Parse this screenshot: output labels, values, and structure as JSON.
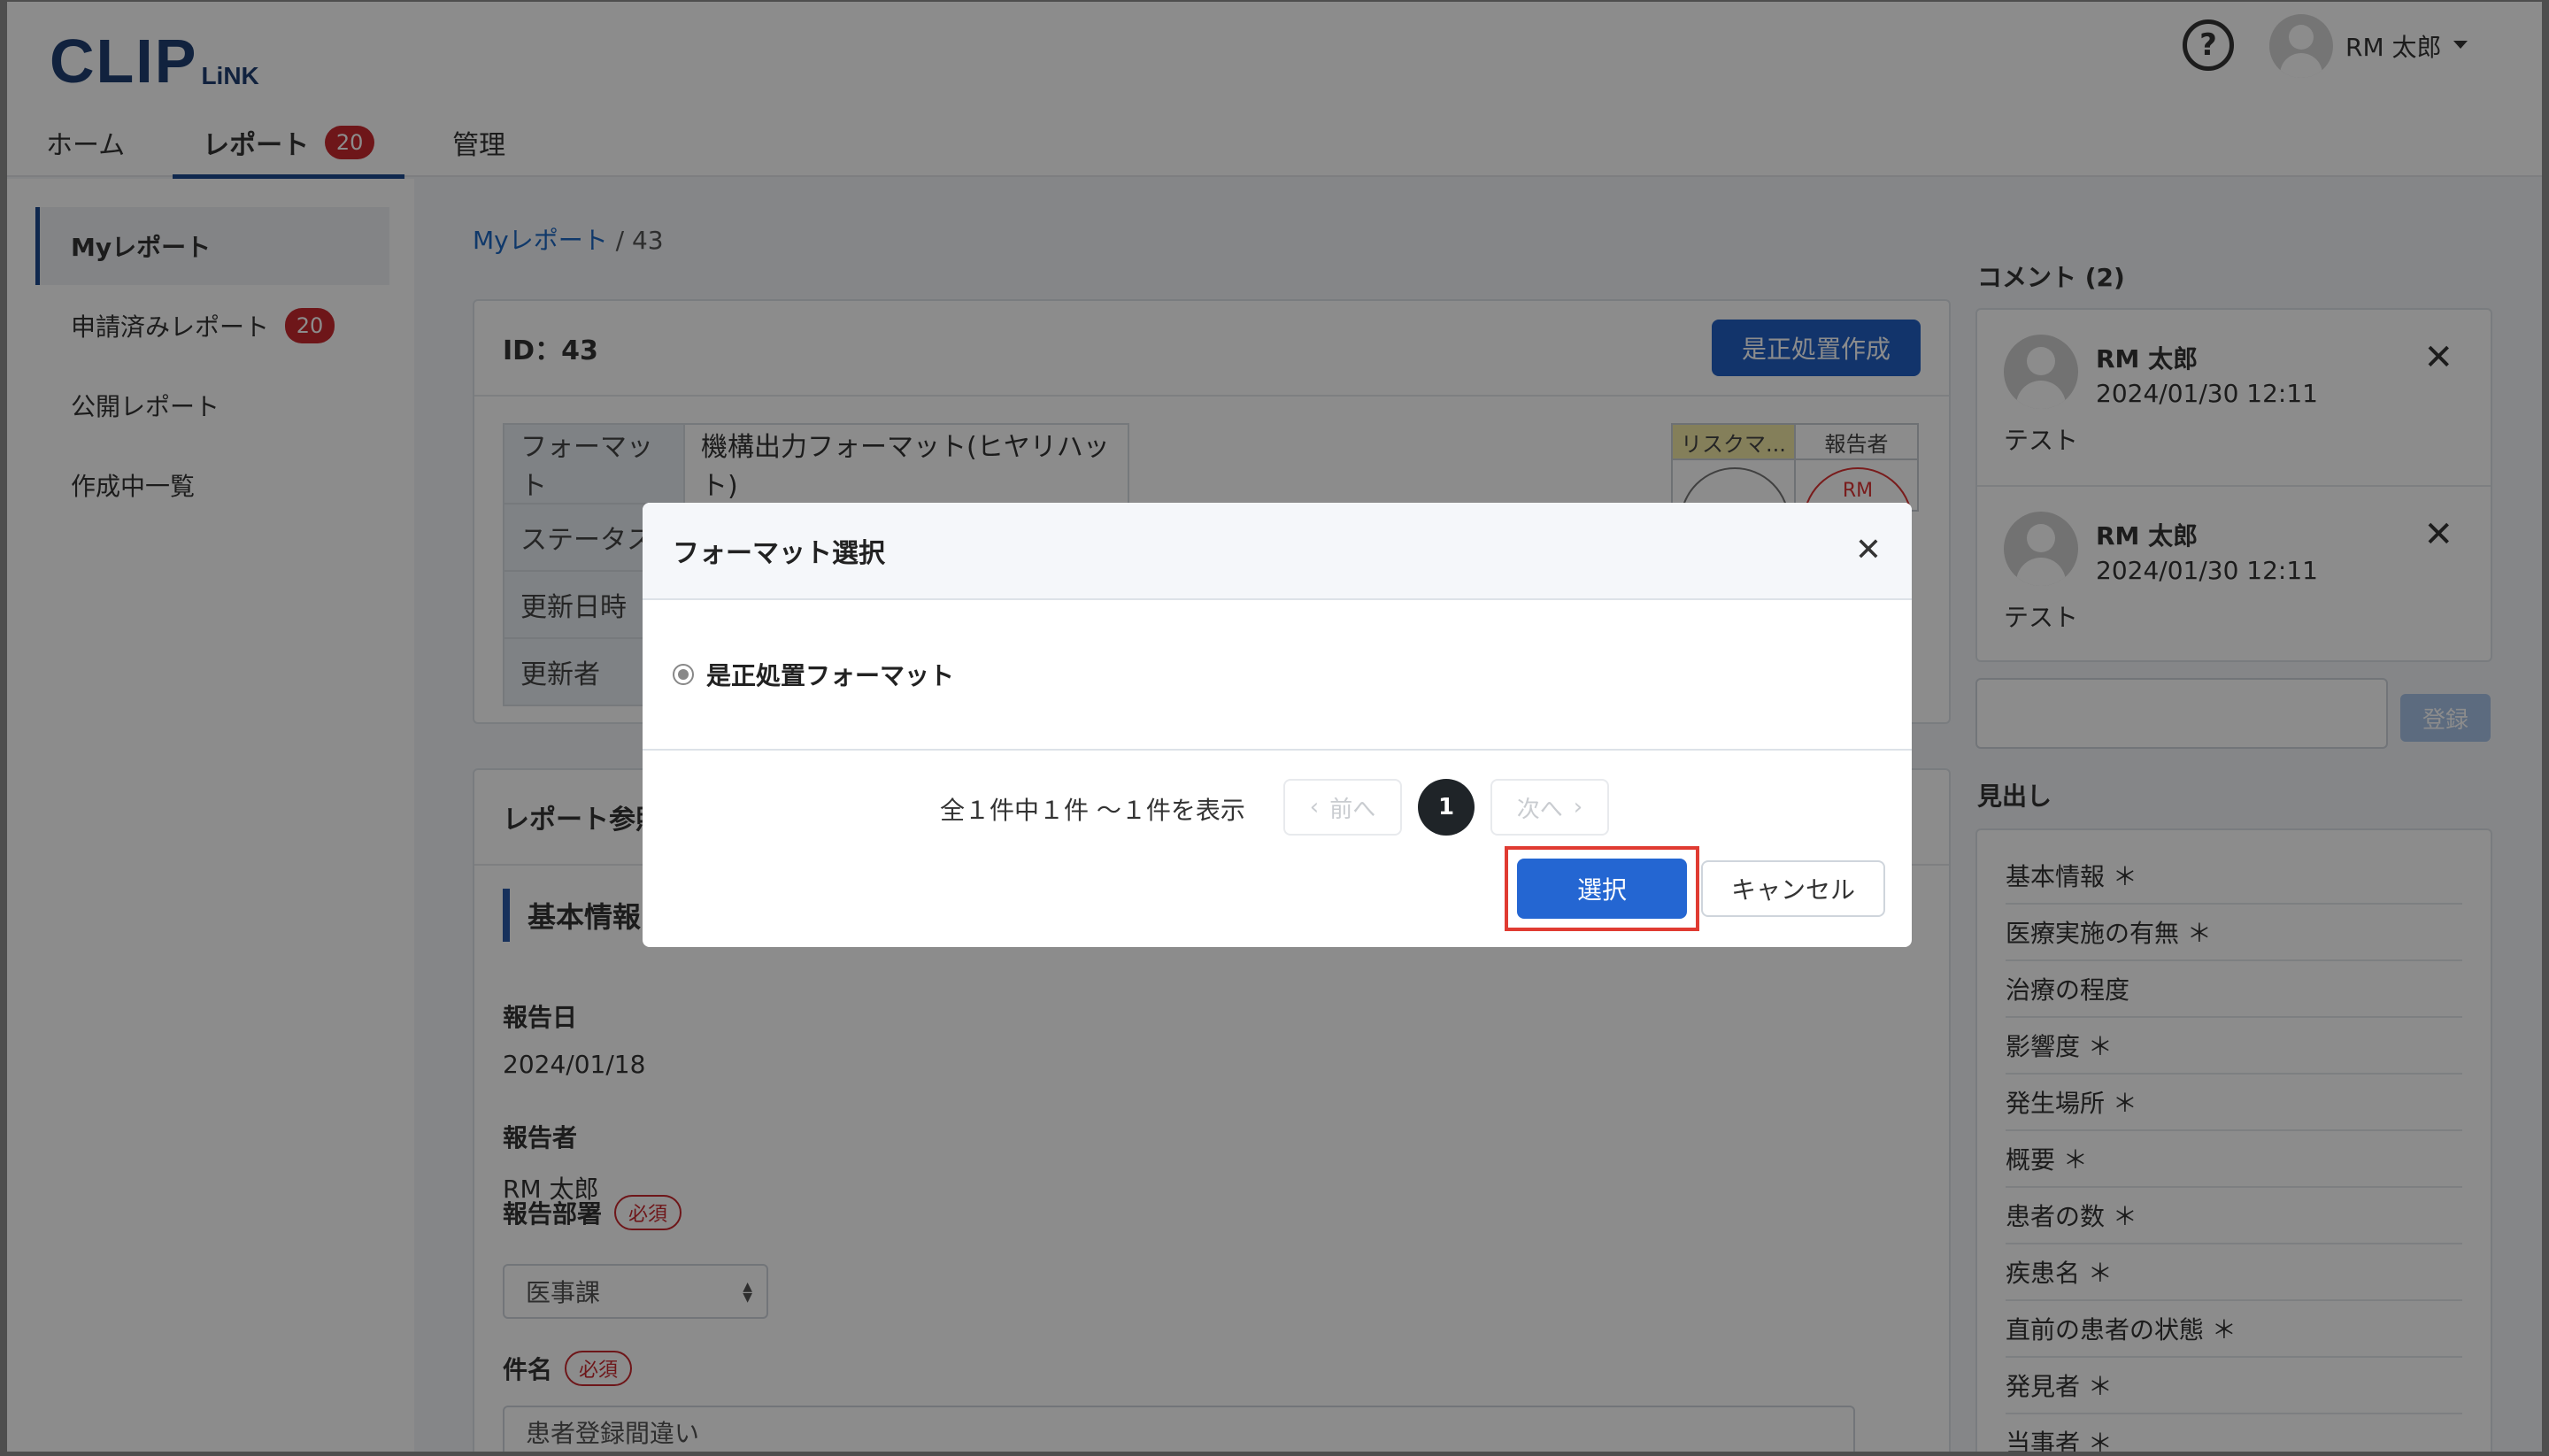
{
  "app": {
    "logo_main": "CLIP",
    "logo_sub": "LiNK",
    "help_icon_glyph": "?",
    "user_name": "RM 太郎"
  },
  "nav": {
    "tabs": [
      {
        "label": "ホーム"
      },
      {
        "label": "レポート",
        "badge": "20"
      },
      {
        "label": "管理"
      }
    ]
  },
  "sidebar": {
    "items": [
      {
        "label": "Myレポート"
      },
      {
        "label": "申請済みレポート",
        "badge": "20"
      },
      {
        "label": "公開レポート"
      },
      {
        "label": "作成中一覧"
      }
    ]
  },
  "breadcrumb": {
    "link": "Myレポート",
    "separator": "/",
    "current": "43"
  },
  "report": {
    "id_label": "ID：43",
    "corrective_button": "是正処置作成",
    "info": [
      {
        "key": "フォーマット",
        "value": "機構出力フォーマット(ヒヤリハット)"
      },
      {
        "key": "ステータス",
        "value": ""
      },
      {
        "key": "更新日時",
        "value": ""
      },
      {
        "key": "更新者",
        "value": ""
      }
    ],
    "stamp": {
      "col1_header": "リスクマ...",
      "col2_header": "報告者",
      "col2_mark": "RM"
    },
    "ref_title": "レポート参照",
    "section_title": "基本情報",
    "fields": {
      "report_date_label": "報告日",
      "report_date_value": "2024/01/18",
      "reporter_label": "報告者",
      "reporter_value": "RM 太郎",
      "dept_label": "報告部署",
      "dept_required": "必須",
      "dept_value": "医事課",
      "subject_label": "件名",
      "subject_required": "必須",
      "subject_value": "患者登録間違い"
    }
  },
  "comments": {
    "title": "コメント (2)",
    "items": [
      {
        "author": "RM 太郎",
        "date": "2024/01/30 12:11",
        "text": "テスト"
      },
      {
        "author": "RM 太郎",
        "date": "2024/01/30 12:11",
        "text": "テスト"
      }
    ],
    "register_button": "登録"
  },
  "headings": {
    "title": "見出し",
    "items": [
      "基本情報 ＊",
      "医療実施の有無 ＊",
      "治療の程度",
      "影響度 ＊",
      "発生場所 ＊",
      "概要 ＊",
      "患者の数 ＊",
      "疾患名 ＊",
      "直前の患者の状態 ＊",
      "発見者 ＊",
      "当事者 ＊"
    ]
  },
  "modal": {
    "title": "フォーマット選択",
    "close_glyph": "✕",
    "option_label": "是正処置フォーマット",
    "option_selected": true,
    "pager_summary": "全１件中１件 〜１件を表示",
    "prev_label": "前へ",
    "next_label": "次へ",
    "current_page": "1",
    "select_button": "選択",
    "cancel_button": "キャンセル",
    "highlight_color": "#e03b32"
  },
  "colors": {
    "primary": "#2160c4",
    "badge": "#c8282e",
    "nav_accent": "#1d4a8f"
  }
}
